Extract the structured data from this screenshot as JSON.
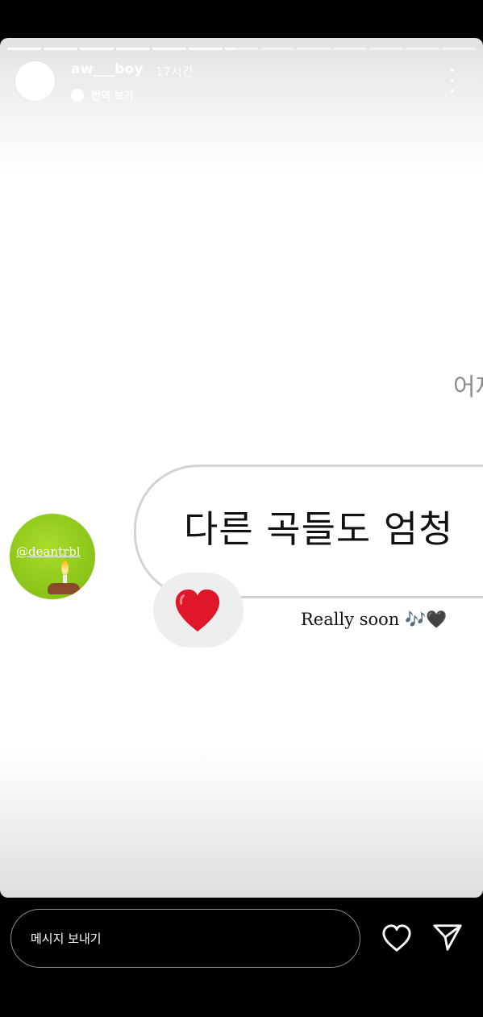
{
  "story": {
    "progress_segments": 13,
    "active_segment_index": 6,
    "active_segment_fraction": 0.3,
    "header": {
      "username": "aw___boy",
      "time_ago": "17시간",
      "translate_label": "번역 보기"
    },
    "content": {
      "cut_text": "어제",
      "bubble_text": "다른 곡들도 엄청",
      "mention": "@deantrbl",
      "caption": "Really soon 🎶🖤",
      "reaction_icon": "red-heart-icon"
    }
  },
  "footer": {
    "message_placeholder": "메시지 보내기",
    "like_icon": "heart-outline-icon",
    "send_icon": "paper-plane-icon"
  },
  "colors": {
    "mention_circle": "#8fc91b",
    "heart_red": "#e0162b",
    "bubble_border": "#d3d3d3"
  }
}
